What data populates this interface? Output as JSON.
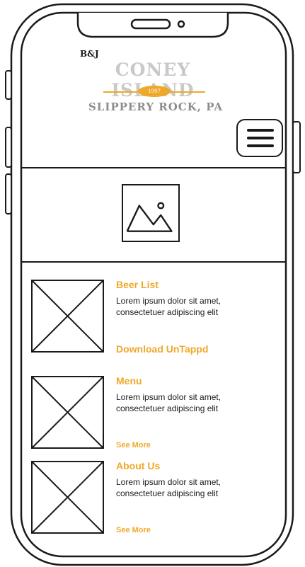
{
  "header": {
    "logo": {
      "brand_prefix": "B&J",
      "name": "CONEY ISLAND",
      "established": "1997",
      "location": "SLIPPERY ROCK, PA"
    }
  },
  "sections": [
    {
      "title": "Beer List",
      "body": "Lorem ipsum dolor sit amet, consectetuer adipiscing elit",
      "link": "Download UnTappd"
    },
    {
      "title": "Menu",
      "body": "Lorem ipsum dolor sit amet, consectetuer adipiscing elit",
      "link": "See More"
    },
    {
      "title": "About Us",
      "body": "Lorem ipsum dolor sit amet, consectetuer adipiscing elit",
      "link": "See More"
    }
  ],
  "colors": {
    "accent": "#f0a82a",
    "outline": "#1a1a1a",
    "logo_gray": "#c9c9c9"
  },
  "icons": [
    "menu-icon",
    "image-placeholder-icon",
    "placeholder-x-icon"
  ]
}
